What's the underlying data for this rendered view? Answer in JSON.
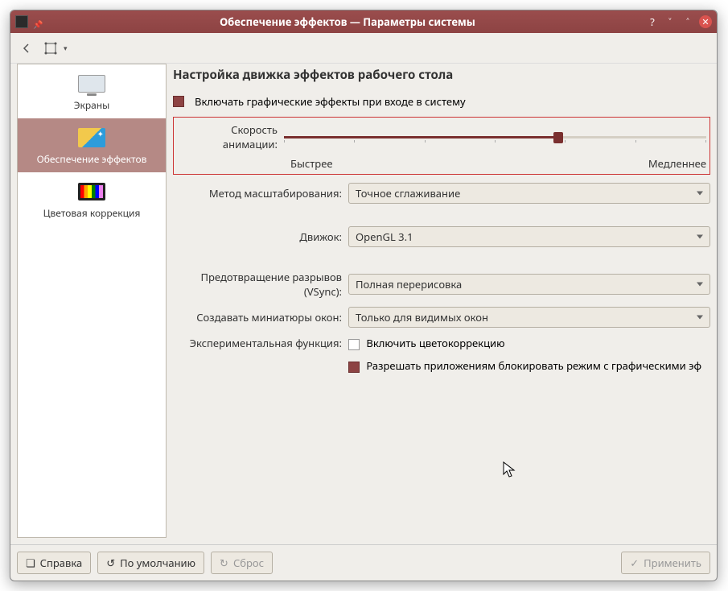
{
  "window": {
    "title": "Обеспечение эффектов  —  Параметры системы"
  },
  "sidebar": {
    "items": [
      {
        "label": "Экраны"
      },
      {
        "label": "Обеспечение эффектов"
      },
      {
        "label": "Цветовая коррекция"
      }
    ]
  },
  "page": {
    "heading": "Настройка движка эффектов рабочего стола",
    "enable_fx": "Включать графические эффекты при входе в систему",
    "speed_label": "Скорость анимации:",
    "speed_fast": "Быстрее",
    "speed_slow": "Медленнее",
    "scaling_label": "Метод масштабирования:",
    "scaling_value": "Точное сглаживание",
    "engine_label": "Движок:",
    "engine_value": "OpenGL 3.1",
    "vsync_label": "Предотвращение разрывов (VSync):",
    "vsync_value": "Полная перерисовка",
    "thumbs_label": "Создавать миниатюры окон:",
    "thumbs_value": "Только для видимых окон",
    "exp_label": "Экспериментальная функция:",
    "color_corr": "Включить цветокоррекцию",
    "allow_block": "Разрешать приложениям блокировать режим с графическими эф"
  },
  "buttons": {
    "help": "Справка",
    "defaults": "По умолчанию",
    "reset": "Сброс",
    "apply": "Применить"
  }
}
